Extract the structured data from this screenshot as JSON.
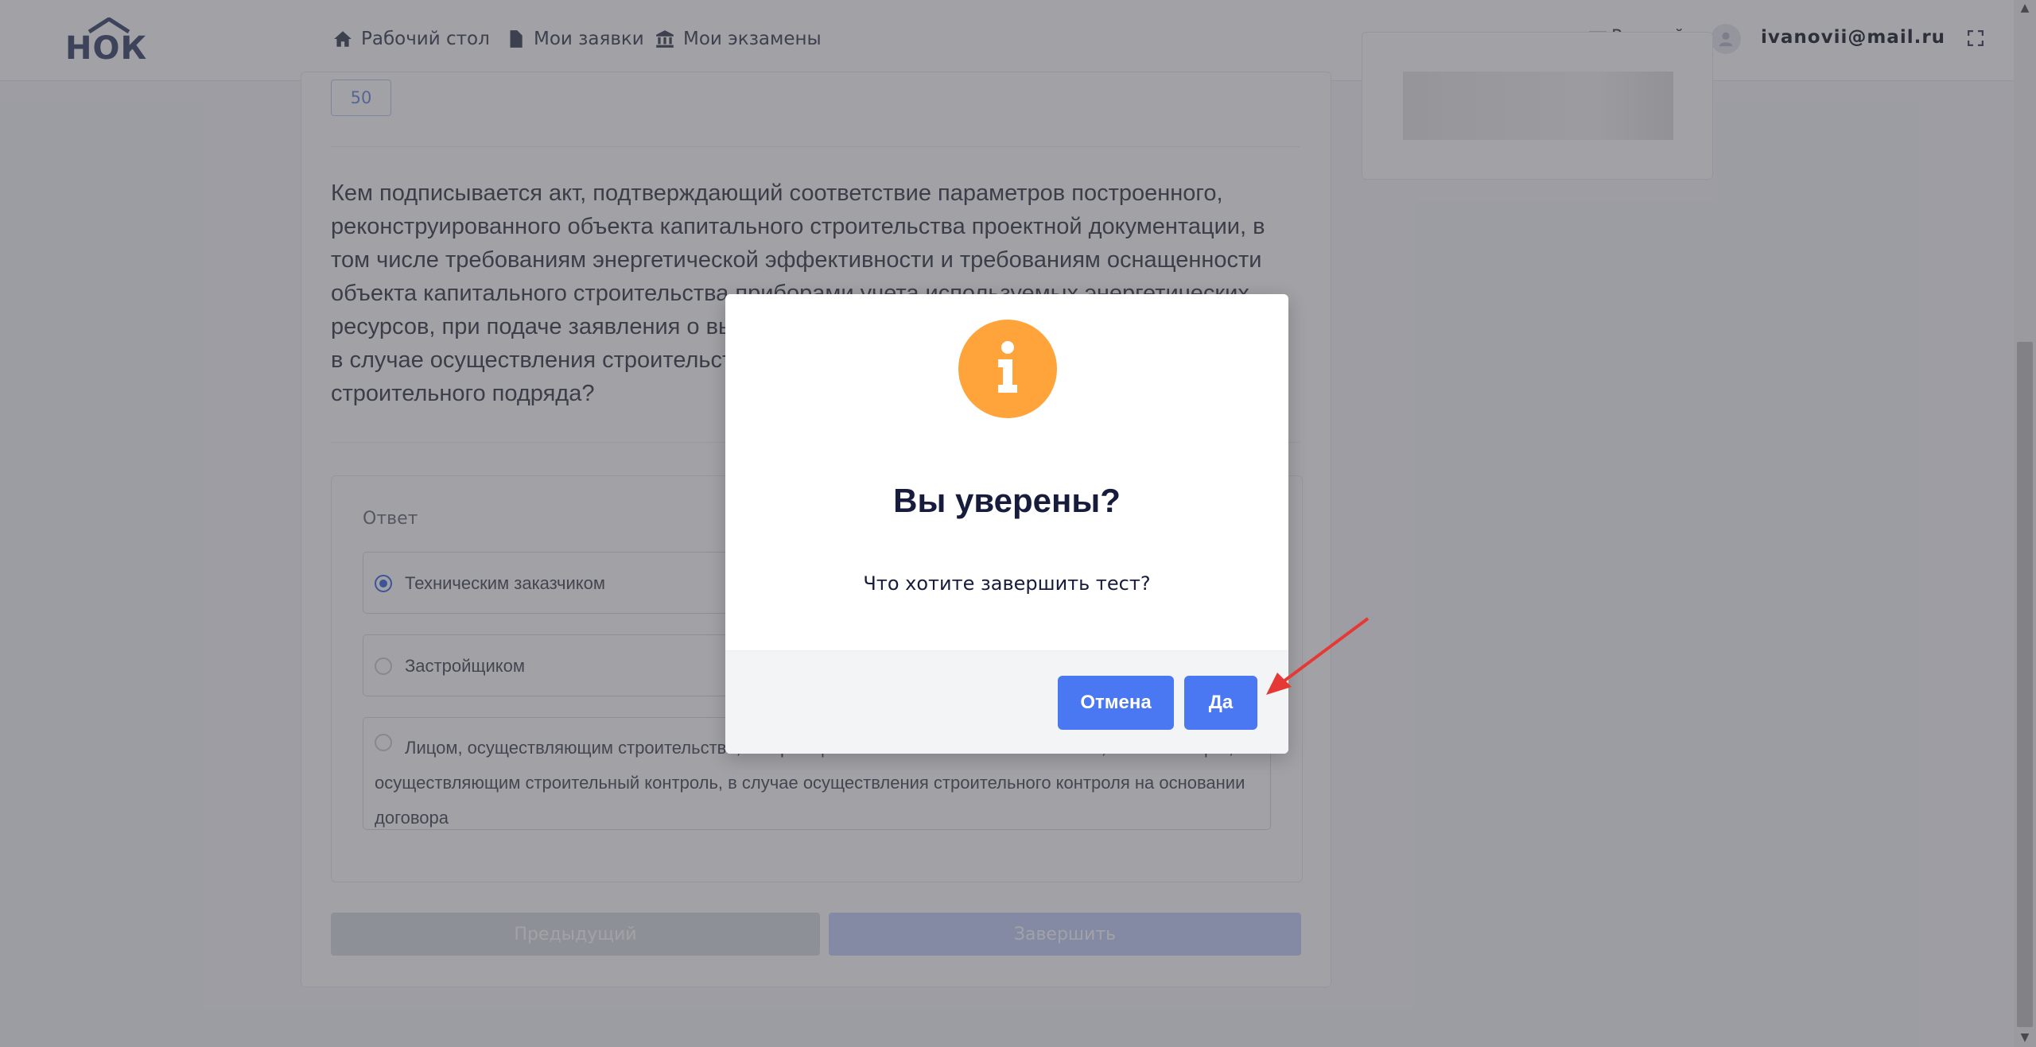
{
  "app": {
    "logo_text": "НОК"
  },
  "nav": {
    "items": [
      {
        "label": "Рабочий стол",
        "icon": "home-icon"
      },
      {
        "label": "Мои заявки",
        "icon": "document-icon"
      },
      {
        "label": "Мои экзамены",
        "icon": "bank-icon"
      }
    ],
    "language": "Русский",
    "user_email": "ivanovii@mail.ru"
  },
  "question": {
    "number": "50",
    "text": "Кем подписывается акт, подтверждающий соответствие параметров построенного, реконструированного объекта капитального строительства проектной документации, в том числе требованиям энергетической эффективности и требованиям оснащенности объекта капитального строительства приборами учета используемых энергетических ресурсов, при подаче заявления о выдаче разрешения на ввод объекта в эксплуатацию в случае осуществления строительства, реконструкции на основании договора строительного подряда?"
  },
  "answers": {
    "label": "Ответ",
    "options": [
      {
        "text": "Техническим заказчиком",
        "selected": true
      },
      {
        "text": "Застройщиком",
        "selected": false
      },
      {
        "text": "Лицом, осуществляющим строительство, застройщиком или техническим заказчиком, а также лицом, осуществляющим строительный контроль, в случае осуществления строительного контроля на основании договора",
        "selected": false
      }
    ]
  },
  "buttons": {
    "prev": "Предыдущий",
    "finish": "Завершить"
  },
  "modal": {
    "icon": "info-icon",
    "title": "Вы уверены?",
    "text": "Что хотите завершить тест?",
    "cancel": "Отмена",
    "confirm": "Да"
  },
  "colors": {
    "modal_button": "#4a78f2",
    "info_icon": "#ffa43a",
    "annotation_arrow": "#e53935"
  }
}
